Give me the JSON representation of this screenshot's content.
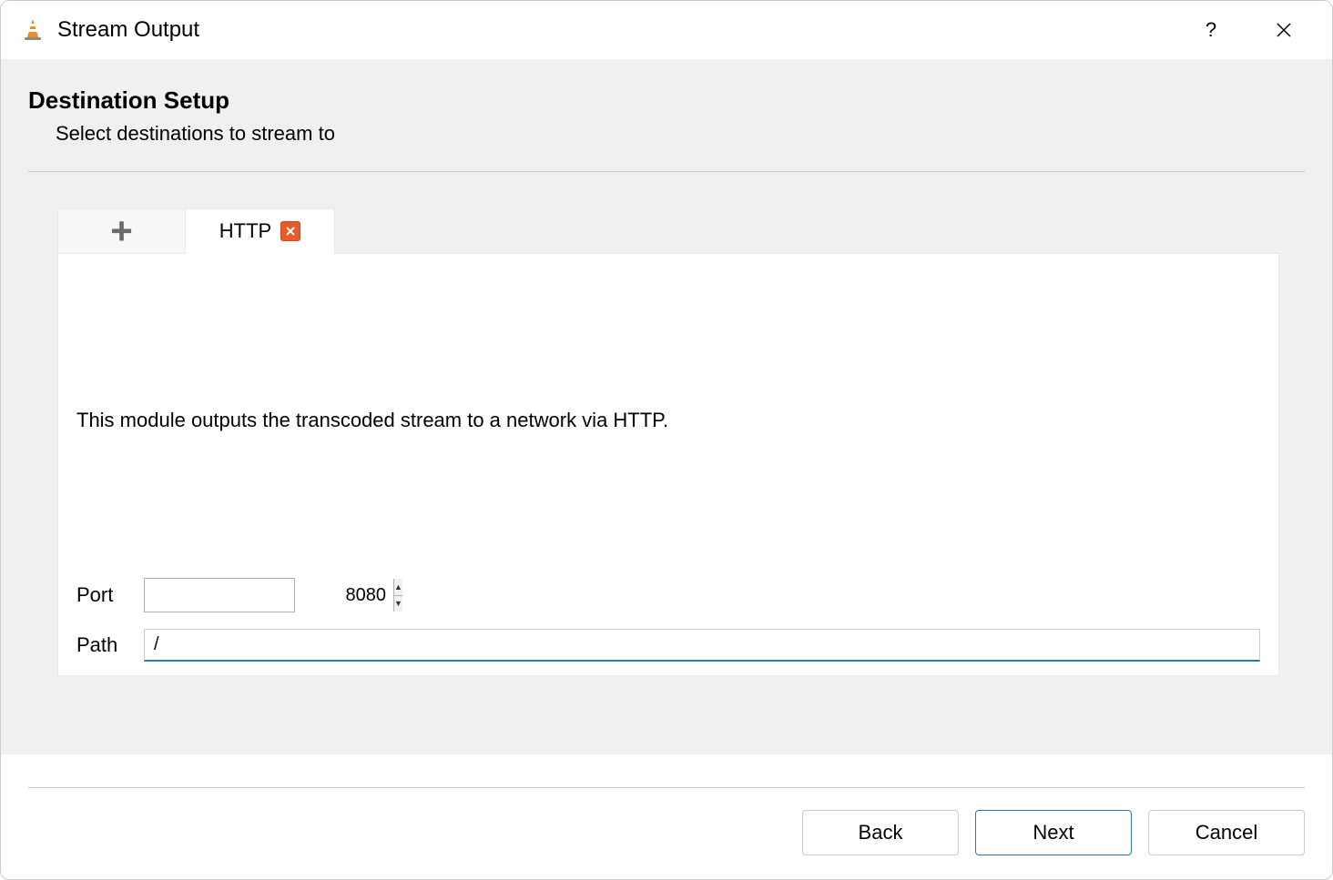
{
  "window": {
    "title": "Stream Output"
  },
  "page": {
    "heading": "Destination Setup",
    "subheading": "Select destinations to stream to"
  },
  "tabs": {
    "active_label": "HTTP"
  },
  "module": {
    "description": "This module outputs the transcoded stream to a network via HTTP.",
    "port_label": "Port",
    "port_value": "8080",
    "path_label": "Path",
    "path_value": "/"
  },
  "buttons": {
    "back": "Back",
    "next": "Next",
    "cancel": "Cancel"
  }
}
